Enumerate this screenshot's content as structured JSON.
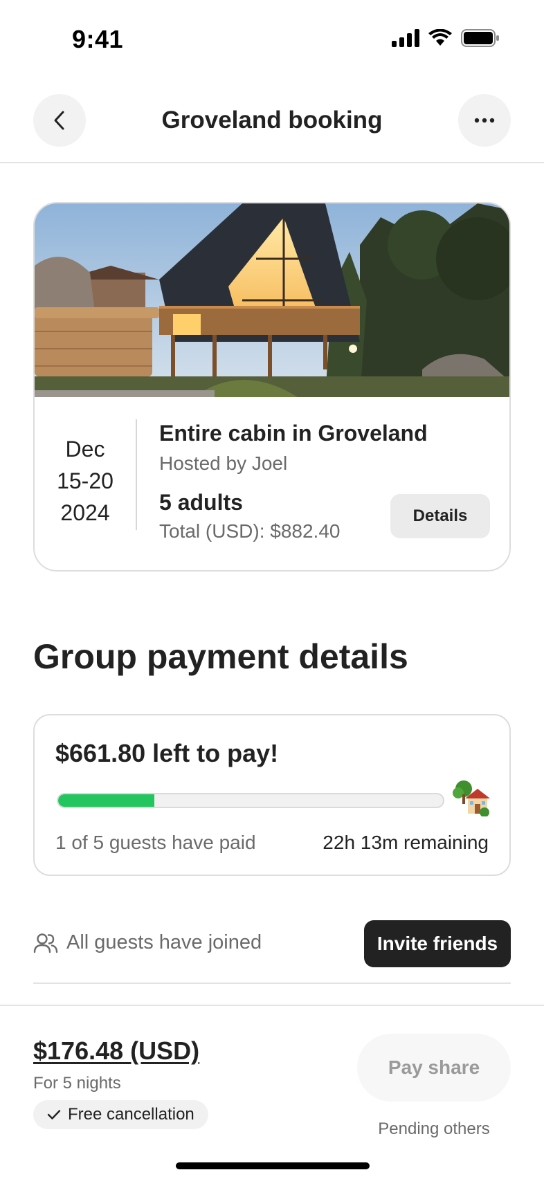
{
  "status_bar": {
    "time": "9:41"
  },
  "header": {
    "title": "Groveland booking"
  },
  "booking": {
    "date_month": "Dec",
    "date_range": "15-20",
    "date_year": "2024",
    "listing_title": "Entire cabin in Groveland",
    "host": "Hosted by Joel",
    "guests": "5 adults",
    "total": "Total (USD): $882.40",
    "details_label": "Details"
  },
  "section": {
    "title": "Group payment details"
  },
  "payment": {
    "left_to_pay": "$661.80 left to pay!",
    "paid_count": "1 of 5 guests have paid",
    "remaining": "22h 13m remaining",
    "progress_fraction": 0.25,
    "progress_color": "#22c55e"
  },
  "guests": {
    "status": "All guests have joined",
    "invite_label": "Invite friends"
  },
  "footer": {
    "price": "$176.48 (USD)",
    "nights": "For 5 nights",
    "cancellation": "Free cancellation",
    "pay_label": "Pay share",
    "pending": "Pending others"
  },
  "icons": {
    "back": "chevron-left-icon",
    "more": "ellipsis-icon",
    "guests": "people-icon",
    "check": "check-icon",
    "house": "house-with-tree-icon"
  }
}
